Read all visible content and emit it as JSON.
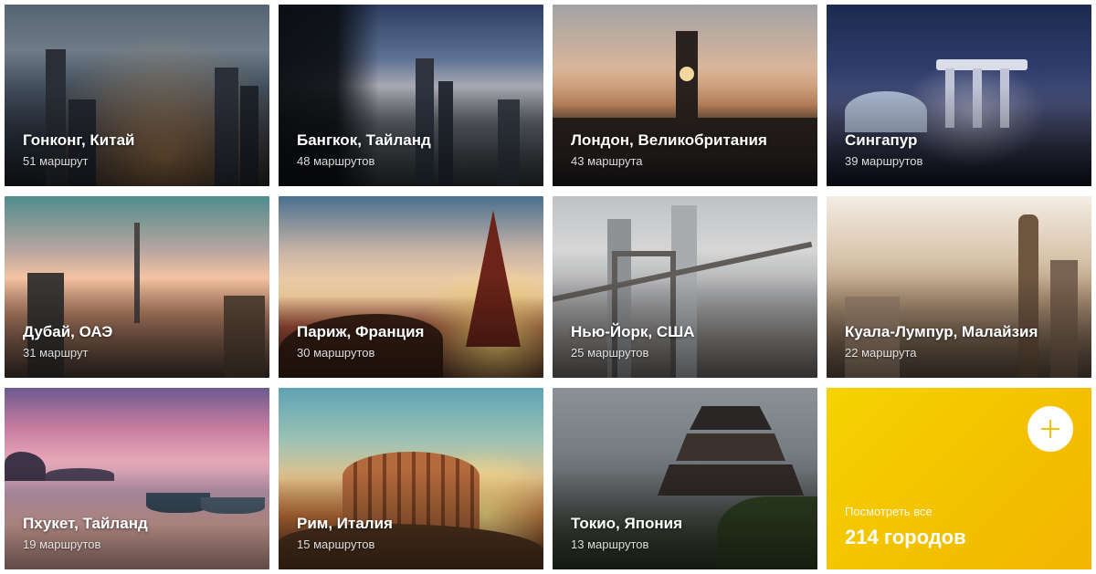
{
  "cities": [
    {
      "name": "Гонконг, Китай",
      "routes": "51 маршрут"
    },
    {
      "name": "Бангкок, Тайланд",
      "routes": "48 маршрутов"
    },
    {
      "name": "Лондон, Великобритания",
      "routes": "43 маршрута"
    },
    {
      "name": "Сингапур",
      "routes": "39 маршрутов"
    },
    {
      "name": "Дубай, ОАЭ",
      "routes": "31 маршрут"
    },
    {
      "name": "Париж, Франция",
      "routes": "30 маршрутов"
    },
    {
      "name": "Нью-Йорк, США",
      "routes": "25 маршрутов"
    },
    {
      "name": "Куала-Лумпур, Малайзия",
      "routes": "22 маршрута"
    },
    {
      "name": "Пхукет, Тайланд",
      "routes": "19 маршрутов"
    },
    {
      "name": "Рим, Италия",
      "routes": "15 маршрутов"
    },
    {
      "name": "Токио, Япония",
      "routes": "13 маршрутов"
    }
  ],
  "view_all": {
    "label": "Посмотреть все",
    "count": "214 городов",
    "icon": "plus-icon",
    "accent_color": "#F5C800"
  }
}
